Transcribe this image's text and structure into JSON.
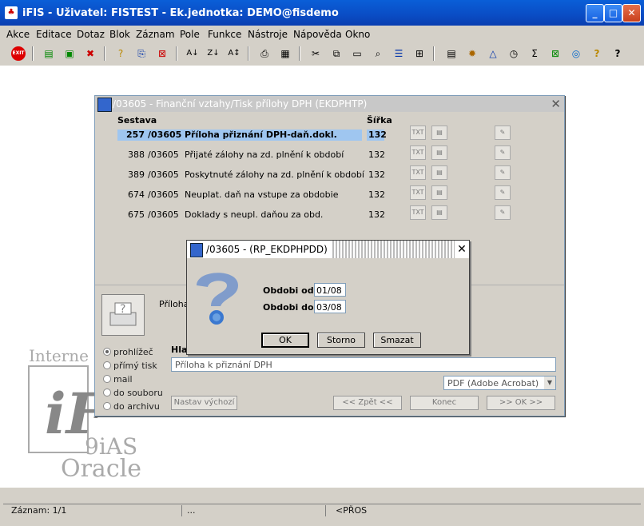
{
  "window": {
    "title": "iFIS - Uživatel: FISTEST - Ek.jednotka: DEMO@fisdemo",
    "app_icon_glyph": "♣"
  },
  "menu": [
    "Akce",
    "Editace",
    "Dotaz",
    "Blok",
    "Záznam",
    "Pole",
    "Funkce",
    "Nástroje",
    "Nápověda",
    "Okno"
  ],
  "toolbar": {
    "exit_label": "EXIT",
    "icons": [
      "exit-icon",
      "new-record-icon",
      "save-icon",
      "delete-record-icon",
      "query-icon",
      "enter-query-icon",
      "cancel-query-icon",
      "sort-asc-icon",
      "sort-desc-icon",
      "sort-multi-icon",
      "print-icon",
      "preview-icon",
      "cut-icon",
      "copy-icon",
      "paste-icon",
      "find-icon",
      "list-icon",
      "tree-icon",
      "form-icon",
      "settings-icon",
      "triangle-icon",
      "clock-icon",
      "sum-icon",
      "excel-icon",
      "web-icon",
      "help-question-icon",
      "help-icon"
    ]
  },
  "background": {
    "logo_internet": "Interne",
    "logo_if": "iF",
    "logo_9ias": "9iAS",
    "logo_oracle": "Oracle"
  },
  "panel": {
    "title": "/03605 - Finanční vztahy/Tisk přílohy DPH (EKDPHTP)",
    "col_sestava": "Sestava",
    "col_sirka": "Šířka",
    "rows": [
      {
        "num": "257",
        "code": "/03605",
        "name": "Příloha přiznání DPH-daň.dokl.",
        "width": "132"
      },
      {
        "num": "388",
        "code": "/03605",
        "name": "Přijaté zálohy na zd. plnění k období",
        "width": "132"
      },
      {
        "num": "389",
        "code": "/03605",
        "name": "Poskytnuté zálohy na zd. plnění k období",
        "width": "132"
      },
      {
        "num": "674",
        "code": "/03605",
        "name": "Neuplat. daň na vstupe za obdobie",
        "width": "132"
      },
      {
        "num": "675",
        "code": "/03605",
        "name": "Doklady s neupl. daňou za obd.",
        "width": "132"
      }
    ],
    "printer_label": "Příloha",
    "output_header": "Hlav",
    "output_field": "Příloha k přiznání DPH",
    "format_select": "PDF (Adobe Acrobat)",
    "radios": [
      "prohlížeč",
      "přímý tisk",
      "mail",
      "do souboru",
      "do archivu"
    ],
    "btn_defaults": "Nastav výchozí",
    "btn_back": "<< Zpět <<",
    "btn_end": "Konec",
    "btn_ok": ">> OK >>"
  },
  "dialog": {
    "title": "/03605 - (RP_EKDPHPDD)",
    "label_from": "Obdobi od:",
    "label_to": "Obdobi do:",
    "value_from": "01/08",
    "value_to": "03/08",
    "btn_ok": "OK",
    "btn_cancel": "Storno",
    "btn_delete": "Smazat"
  },
  "status": {
    "record": "Záznam: 1/1",
    "dots": "...",
    "mode": "<PŘOS"
  }
}
